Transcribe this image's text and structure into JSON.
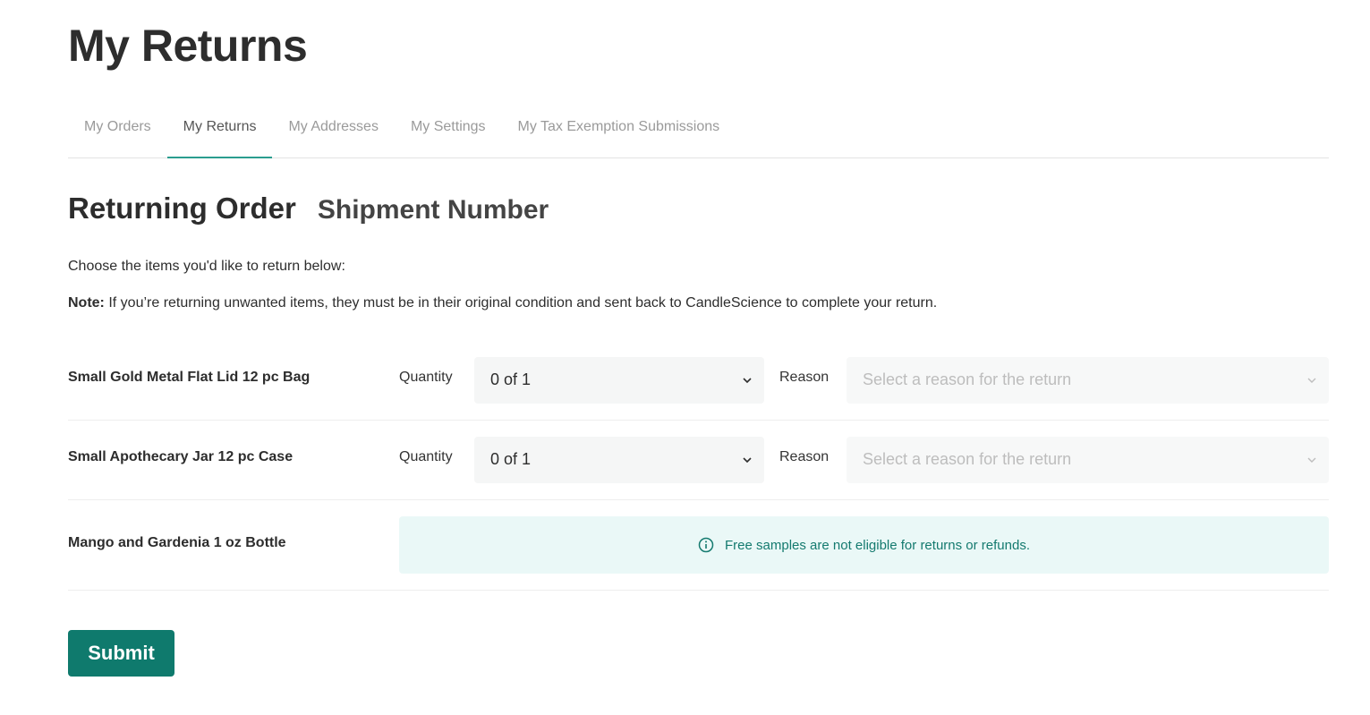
{
  "page": {
    "title": "My Returns"
  },
  "tabs": [
    {
      "label": "My Orders",
      "active": false
    },
    {
      "label": "My Returns",
      "active": true
    },
    {
      "label": "My Addresses",
      "active": false
    },
    {
      "label": "My Settings",
      "active": false
    },
    {
      "label": "My Tax Exemption Submissions",
      "active": false
    }
  ],
  "returning": {
    "heading": "Returning Order",
    "subheading": "Shipment Number",
    "intro": "Choose the items you'd like to return below:",
    "note_label": "Note:",
    "note_text": " If you’re returning unwanted items, they must be in their original condition and sent back to CandleScience to complete your return."
  },
  "items": [
    {
      "name": "Small Gold Metal Flat Lid 12 pc Bag",
      "quantity_label": "Quantity",
      "quantity_value": "0 of 1",
      "reason_label": "Reason",
      "reason_placeholder": "Select a reason for the return"
    },
    {
      "name": "Small Apothecary Jar 12 pc Case",
      "quantity_label": "Quantity",
      "quantity_value": "0 of 1",
      "reason_label": "Reason",
      "reason_placeholder": "Select a reason for the return"
    },
    {
      "name": "Mango and Gardenia 1 oz Bottle",
      "notice": "Free samples are not eligible for returns or refunds."
    }
  ],
  "actions": {
    "submit_label": "Submit"
  },
  "colors": {
    "accent": "#0f7a6d",
    "tab_underline": "#2a9d8f",
    "notice_bg": "#eaf8f7",
    "notice_text": "#147a6f"
  },
  "icons": {
    "select_chevron": "chevron-down-icon",
    "notice": "info-circle-icon"
  }
}
